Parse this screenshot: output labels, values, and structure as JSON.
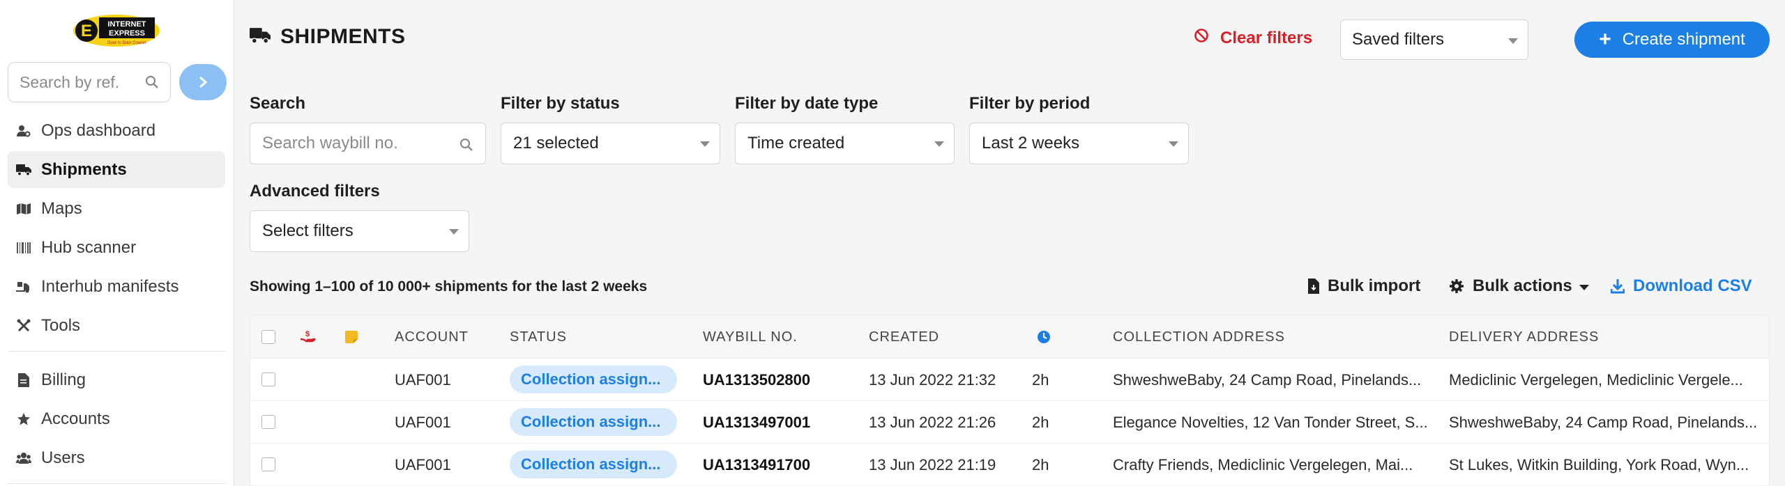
{
  "sidebar": {
    "logo_text": "INTERNET EXPRESS",
    "logo_tagline": "Door to Door Courier",
    "search_placeholder": "Search by ref.",
    "items": [
      {
        "label": "Ops dashboard",
        "icon": "user-cog-icon"
      },
      {
        "label": "Shipments",
        "icon": "truck-icon",
        "active": true
      },
      {
        "label": "Maps",
        "icon": "map-icon"
      },
      {
        "label": "Hub scanner",
        "icon": "barcode-icon"
      },
      {
        "label": "Interhub manifests",
        "icon": "truck-loading-icon"
      },
      {
        "label": "Tools",
        "icon": "tools-icon"
      },
      {
        "label": "Billing",
        "icon": "invoice-icon"
      },
      {
        "label": "Accounts",
        "icon": "star-icon"
      },
      {
        "label": "Users",
        "icon": "users-icon"
      }
    ]
  },
  "header": {
    "title": "SHIPMENTS",
    "clear_filters": "Clear filters",
    "saved_filters": "Saved filters",
    "create_shipment": "Create shipment"
  },
  "filters": {
    "search_label": "Search",
    "search_placeholder": "Search waybill no.",
    "status_label": "Filter by status",
    "status_value": "21 selected",
    "date_type_label": "Filter by date type",
    "date_type_value": "Time created",
    "period_label": "Filter by period",
    "period_value": "Last 2 weeks",
    "advanced_label": "Advanced filters",
    "advanced_value": "Select filters"
  },
  "results": {
    "showing_text": "Showing 1–100 of 10 000+ shipments for the last 2 weeks",
    "bulk_import": "Bulk import",
    "bulk_actions": "Bulk actions",
    "download_csv": "Download CSV"
  },
  "table": {
    "columns": [
      "ACCOUNT",
      "STATUS",
      "WAYBILL NO.",
      "CREATED",
      "COLLECTION ADDRESS",
      "DELIVERY ADDRESS"
    ],
    "rows": [
      {
        "account": "UAF001",
        "status": "Collection assign...",
        "waybill": "UA1313502800",
        "created": "13 Jun 2022 21:32",
        "age": "2h",
        "collection": "ShweshweBaby, 24 Camp Road, Pinelands...",
        "delivery": "Mediclinic Vergelegen, Mediclinic Vergele..."
      },
      {
        "account": "UAF001",
        "status": "Collection assign...",
        "waybill": "UA1313497001",
        "created": "13 Jun 2022 21:26",
        "age": "2h",
        "collection": "Elegance Novelties, 12 Van Tonder Street, S...",
        "delivery": "ShweshweBaby, 24 Camp Road, Pinelands..."
      },
      {
        "account": "UAF001",
        "status": "Collection assign...",
        "waybill": "UA1313491700",
        "created": "13 Jun 2022 21:19",
        "age": "2h",
        "collection": "Crafty Friends, Mediclinic Vergelegen, Mai...",
        "delivery": "St Lukes, Witkin Building, York Road, Wyn..."
      }
    ]
  },
  "colors": {
    "accent": "#1c7fe6",
    "danger": "#d81f26",
    "badge_bg": "#d6eafb"
  }
}
